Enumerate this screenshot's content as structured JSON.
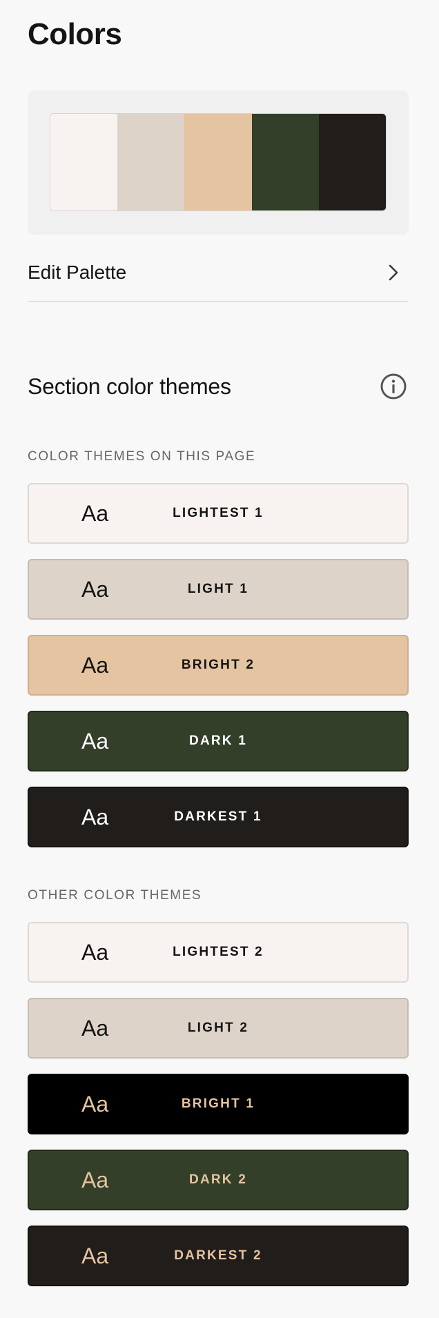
{
  "page": {
    "title": "Colors"
  },
  "palette": {
    "swatches": [
      "#f8f3f0",
      "#ddd3c8",
      "#e4c4a1",
      "#333f29",
      "#201d1b"
    ],
    "edit_label": "Edit Palette"
  },
  "section_themes": {
    "title": "Section color themes",
    "on_page_label": "COLOR THEMES ON THIS PAGE",
    "other_label": "OTHER COLOR THEMES",
    "on_page": [
      {
        "sample": "Aa",
        "name": "LIGHTEST 1",
        "bg": "#f8f3f0",
        "text_color": "#141414"
      },
      {
        "sample": "Aa",
        "name": "LIGHT 1",
        "bg": "#ddd3c8",
        "text_color": "#141414"
      },
      {
        "sample": "Aa",
        "name": "BRIGHT 2",
        "bg": "#e4c4a1",
        "text_color": "#141414"
      },
      {
        "sample": "Aa",
        "name": "DARK 1",
        "bg": "#333f29",
        "text_color": "#ffffff"
      },
      {
        "sample": "Aa",
        "name": "DARKEST 1",
        "bg": "#201d1b",
        "text_color": "#ffffff"
      }
    ],
    "other": [
      {
        "sample": "Aa",
        "name": "LIGHTEST 2",
        "bg": "#f8f3f0",
        "text_color": "#141414"
      },
      {
        "sample": "Aa",
        "name": "LIGHT 2",
        "bg": "#ddd3c8",
        "text_color": "#141414"
      },
      {
        "sample": "Aa",
        "name": "BRIGHT 1",
        "bg": "#000000",
        "text_color": "#e4c4a1"
      },
      {
        "sample": "Aa",
        "name": "DARK 2",
        "bg": "#333f29",
        "text_color": "#e4c4a1"
      },
      {
        "sample": "Aa",
        "name": "DARKEST 2",
        "bg": "#201d1b",
        "text_color": "#e4c4a1"
      }
    ]
  },
  "icons": {
    "edit_palette_chevron": "chevron-right-icon",
    "section_info": "info-icon"
  }
}
